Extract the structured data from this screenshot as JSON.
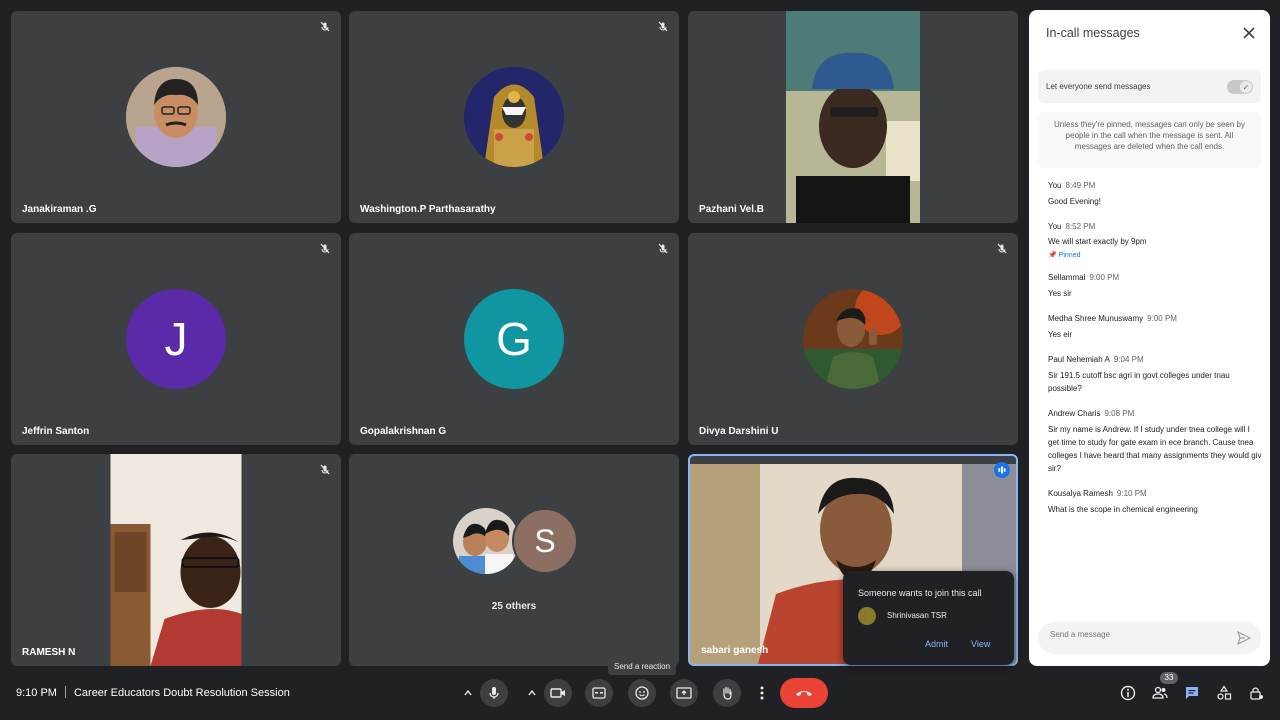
{
  "participants": [
    {
      "name": "Janakiraman .G"
    },
    {
      "name": "Washington.P Parthasarathy"
    },
    {
      "name": "Pazhani Vel.B"
    },
    {
      "name": "Jeffrin Santon",
      "initial": "J",
      "color": "#5b2aa8"
    },
    {
      "name": "Gopalakrishnan G",
      "initial": "G",
      "color": "#0f96a0"
    },
    {
      "name": "Divya Darshini U"
    },
    {
      "name": "RAMESH N"
    },
    {
      "name": "25 others",
      "initial": "S",
      "color": "#8d6e63"
    },
    {
      "name": "sabari ganesh"
    }
  ],
  "panel": {
    "title": "In-call messages",
    "toggle_label": "Let everyone send messages",
    "info": "Unless they're pinned, messages can only be seen by people in the call when the message is sent. All messages are deleted when the call ends.",
    "messages": [
      {
        "sender": "You",
        "time": "8:49 PM",
        "text": "Good Evening!"
      },
      {
        "sender": "You",
        "time": "8:52 PM",
        "text": "We will start exactly by 9pm",
        "pinned": "Pinned"
      },
      {
        "sender": "Sellammal",
        "time": "9:00 PM",
        "text": "Yes sir"
      },
      {
        "sender": "Medha Shree Munuswamy",
        "time": "9:00 PM",
        "text": "Yes eir"
      },
      {
        "sender": "Paul Nehemiah A",
        "time": "9:04 PM",
        "text": "Sir 191.5 cutoff bsc agri in govt colleges under tnau possible?"
      },
      {
        "sender": "Andrew Charis",
        "time": "9:08 PM",
        "text": "Sir my name is Andrew.  If I study under tnea college will I get time to study for gate exam in ece branch. Cause tnea colleges I have heard that many assignments they would giv sir?"
      },
      {
        "sender": "Kousalya Ramesh",
        "time": "9:10 PM",
        "text": "What is the scope in chemical engineering"
      }
    ],
    "send_placeholder": "Send a message"
  },
  "join_popup": {
    "title": "Someone wants to join this call",
    "person": "Shrinivasan TSR",
    "admit": "Admit",
    "view": "View"
  },
  "bottom": {
    "time": "9:10 PM",
    "meeting": "Career Educators Doubt Resolution Session",
    "tooltip": "Send a reaction",
    "people_count": "33"
  },
  "colors": {
    "accent": "#8ab4f8",
    "hangup": "#ea4335",
    "tile": "#3c4043",
    "bg": "#202124"
  }
}
